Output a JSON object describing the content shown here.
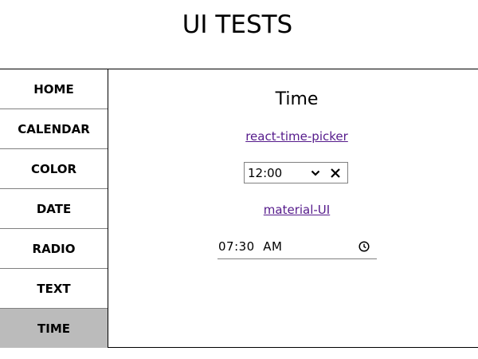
{
  "header": {
    "title": "UI TESTS"
  },
  "sidebar": {
    "items": [
      {
        "label": "HOME"
      },
      {
        "label": "CALENDAR"
      },
      {
        "label": "COLOR"
      },
      {
        "label": "DATE"
      },
      {
        "label": "RADIO"
      },
      {
        "label": "TEXT"
      },
      {
        "label": "TIME"
      }
    ],
    "active_item": "TIME"
  },
  "main": {
    "section_title": "Time",
    "react_time_picker": {
      "link_label": "react-time-picker",
      "value": "12:00",
      "chevron_icon": "chevron-down-icon",
      "clear_icon": "close-icon"
    },
    "material_ui": {
      "link_label": "material-UI",
      "value": "07:30  AM",
      "clock_icon": "clock-icon"
    }
  },
  "colors": {
    "active_nav_bg": "#bbbbbb",
    "visited_link": "#551a8b",
    "border": "#808080"
  }
}
